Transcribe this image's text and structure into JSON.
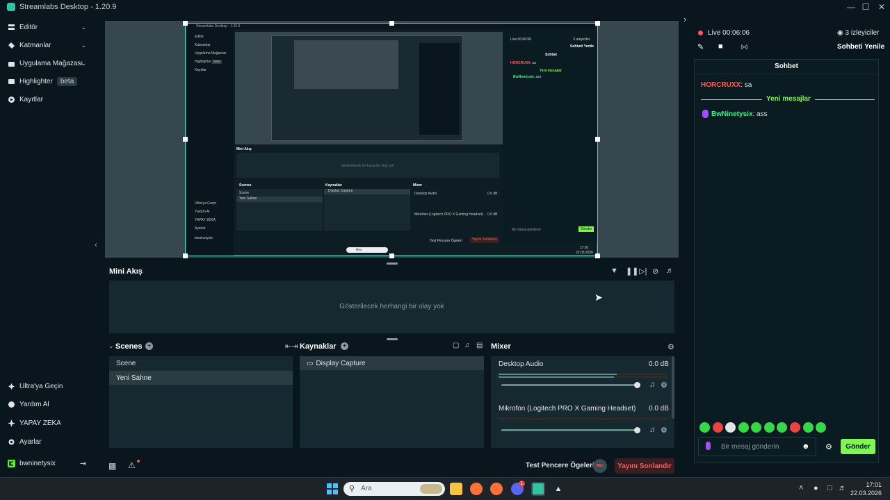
{
  "window": {
    "title": "Streamlabs Desktop - 1.20.9"
  },
  "sidenav": {
    "items": [
      {
        "label": "Editör",
        "icon": "editor-icon"
      },
      {
        "label": "Katmanlar",
        "icon": "layers-icon"
      },
      {
        "label": "Uygulama Mağazası",
        "icon": "app-store-icon"
      },
      {
        "label": "Highlighter",
        "icon": "highlighter-icon",
        "badge": "beta"
      },
      {
        "label": "Kayıtlar",
        "icon": "recordings-icon"
      }
    ],
    "bottom": [
      {
        "label": "Ultra'ya Geçin",
        "icon": "ultra-icon"
      },
      {
        "label": "Yardım Al",
        "icon": "help-icon"
      },
      {
        "label": "YAPAY ZEKA",
        "icon": "ai-icon"
      },
      {
        "label": "Ayarlar",
        "icon": "settings-icon"
      }
    ],
    "user": "bwninetysix"
  },
  "nested": {
    "title": "Streamlabs Desktop - 1.20.9",
    "items": [
      "Editör",
      "Katmanlar",
      "Uygulama Mağazası",
      "Highlighter",
      "Kayıtlar"
    ],
    "badge": "beta",
    "bottom": [
      "Ultra'ya Geçin",
      "Yardım Al",
      "YAPAY ZEKA",
      "Ayarlar",
      "bwninetysix"
    ],
    "mini": "Mini Akış",
    "empty": "Gösterilecek herhangi bir olay yok",
    "scenes": "Scenes",
    "scene1": "Scene",
    "scene2": "Yeni Sahne",
    "sources": "Kaynaklar",
    "source1": "Display Capture",
    "mixer": "Mixer",
    "audio1": "Desktop Audio",
    "audio2": "Mikrofon (Logitech PRO X Gaming Headset)",
    "db": "0.0 dB",
    "test": "Test Pencere Ögeleri",
    "stop": "Yayını Sonlandır",
    "live": "Live 00:06:06",
    "viewers": "3 izleyiciler",
    "refresh": "Sohbeti Yenile",
    "chat": "Sohbet",
    "user1": "HORCRUXX",
    "msg1": ": sa",
    "newmsgs": "Yeni mesajlar",
    "user2": "BwNinetysix",
    "msg2": ": ass",
    "placeholder": "Bir mesaj gönderin",
    "send": "Gönder",
    "search": "Ara",
    "time": "17:01",
    "date": "22.03.2026"
  },
  "mini": {
    "title": "Mini Akış",
    "empty_text": "Gösterilecek herhangi bir olay yok"
  },
  "scenes": {
    "title": "Scenes",
    "items": [
      "Scene",
      "Yeni Sahne"
    ],
    "selected_index": 1
  },
  "sources": {
    "title": "Kaynaklar",
    "items": [
      "Display Capture"
    ]
  },
  "mixer": {
    "title": "Mixer",
    "channels": [
      {
        "name": "Desktop Audio",
        "level": "0.0 dB"
      },
      {
        "name": "Mikrofon (Logitech PRO X Gaming Headset)",
        "level": "0.0 dB"
      }
    ]
  },
  "footer": {
    "test_label": "Test Pencere Ögeleri",
    "rec_label": "REC",
    "stop_label": "Yayını Sonlandır"
  },
  "stream": {
    "live_label": "Live",
    "live_time": "00:06:06",
    "viewers": "3 izleyiciler",
    "refresh_label": "Sohbeti Yenile"
  },
  "chat": {
    "title": "Sohbet",
    "messages": [
      {
        "user": "HORCRUXX",
        "text": ": sa"
      },
      {
        "user": "BwNinetysix",
        "text": ": ass"
      }
    ],
    "divider": "Yeni mesajlar",
    "placeholder": "Bir mesaj gönderin",
    "send_label": "Gönder"
  },
  "taskbar": {
    "search_placeholder": "Ara",
    "time": "17:01",
    "date": "22.03.2026",
    "discord_badge": "1"
  },
  "colors": {
    "accent": "#80f556",
    "teal": "#31c3a2",
    "live_red": "#ff5858",
    "user_red": "#ff5a5a",
    "user_green": "#3cf58a",
    "divider_green": "#80f556"
  }
}
